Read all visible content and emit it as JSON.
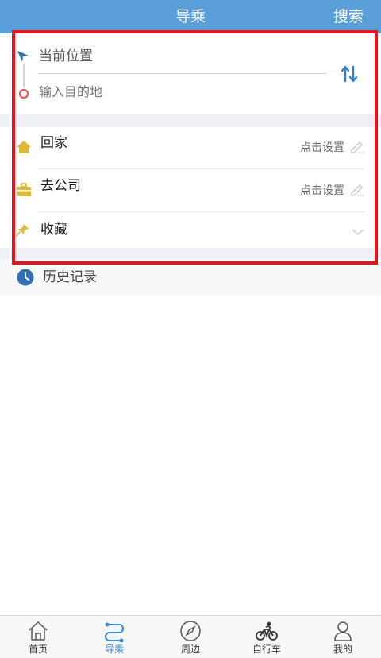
{
  "header": {
    "title": "导乘",
    "search_label": "搜索",
    "background": "#5b9fd9"
  },
  "route": {
    "origin_label": "当前位置",
    "destination_placeholder": "输入目的地",
    "start_icon": "navigation-arrow-icon",
    "end_icon": "destination-circle-icon",
    "swap_icon": "swap-vertical-icon"
  },
  "shortcuts": {
    "home": {
      "label": "回家",
      "action": "点击设置",
      "icon": "home-icon"
    },
    "work": {
      "label": "去公司",
      "action": "点击设置",
      "icon": "briefcase-icon"
    },
    "favorites": {
      "label": "收藏",
      "icon": "pin-icon"
    }
  },
  "history": {
    "label": "历史记录",
    "icon": "clock-icon"
  },
  "tabbar": {
    "tabs": [
      {
        "label": "首页",
        "icon": "home-outline-icon",
        "active": false
      },
      {
        "label": "导乘",
        "icon": "route-icon",
        "active": true
      },
      {
        "label": "周边",
        "icon": "compass-icon",
        "active": false
      },
      {
        "label": "自行车",
        "icon": "bicycle-icon",
        "active": false
      },
      {
        "label": "我的",
        "icon": "user-icon",
        "active": false
      }
    ]
  },
  "colors": {
    "accent": "#3a8ad0",
    "highlight_border": "#e8141b",
    "icon_yellow": "#e0b93a",
    "destination_red": "#e45a5a"
  }
}
